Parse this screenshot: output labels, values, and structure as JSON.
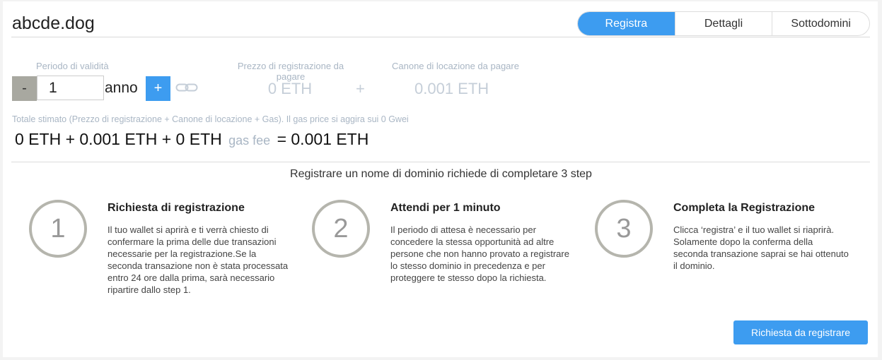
{
  "header": {
    "domain": "abcde.dog",
    "tabs": [
      "Registra",
      "Dettagli",
      "Sottodomini"
    ]
  },
  "period": {
    "label": "Periodo di validità",
    "minus": "-",
    "value": "1",
    "unit": "anno",
    "plus": "+"
  },
  "price": {
    "label": "Prezzo di registrazione da pagare",
    "value": "0 ETH",
    "plus_sign": "+"
  },
  "rent": {
    "label": "Canone di locazione da pagare",
    "value": "0.001 ETH"
  },
  "total": {
    "label": "Totale stimato (Prezzo di registrazione + Canone di locazione + Gas). Il gas price si aggira sui 0 Gwei",
    "equation_start": "0 ETH + 0.001 ETH + 0 ETH",
    "gas_fee": "gas fee",
    "equation_end": "= 0.001 ETH"
  },
  "steps": {
    "title": "Registrare un nome di dominio richiede di completare 3 step",
    "items": [
      {
        "number": "1",
        "title": "Richiesta di registrazione",
        "text": "Il tuo wallet si aprirà e ti verrà chiesto di confermare la prima delle due transazioni necessarie per la registrazione.Se la seconda transazione non è stata processata entro 24 ore dalla prima, sarà necessario ripartire dallo step 1."
      },
      {
        "number": "2",
        "title": "Attendi per 1 minuto",
        "text": "Il periodo di attesa è necessario per concedere la stessa opportunità ad altre persone che non hanno provato a registrare lo stesso dominio in precedenza e per proteggere te stesso dopo la richiesta."
      },
      {
        "number": "3",
        "title": "Completa la Registrazione",
        "text": "Clicca ‘registra’ e il tuo wallet si riaprirà. Solamente dopo la conferma della seconda transazione saprai se hai ottenuto il dominio."
      }
    ]
  },
  "action": {
    "button": "Richiesta da registrare"
  },
  "icons": {
    "link": "link-icon"
  },
  "colors": {
    "accent": "#3d9cf0",
    "muted_text": "#a9b6c4"
  }
}
